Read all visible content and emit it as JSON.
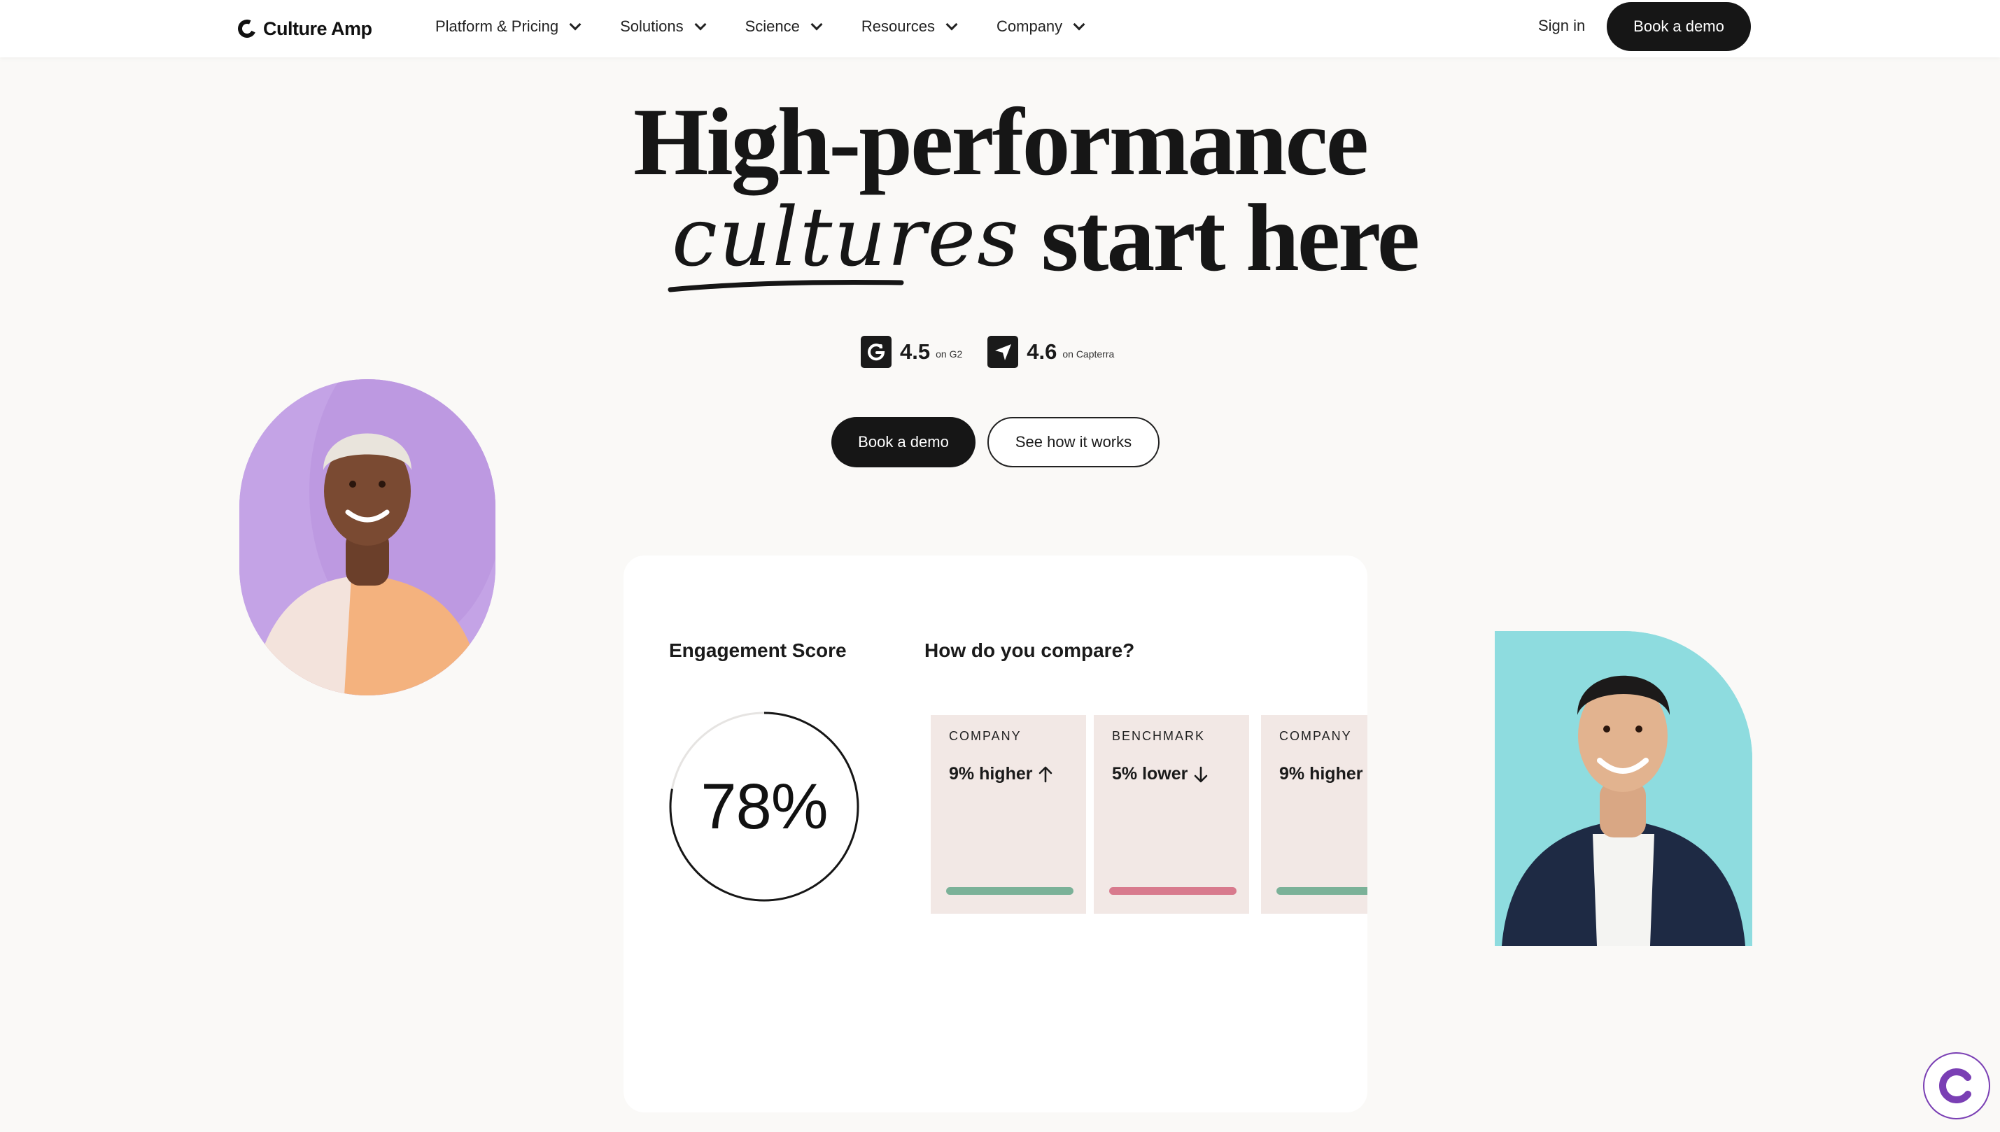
{
  "brand": {
    "name": "Culture Amp"
  },
  "nav": {
    "items": [
      {
        "label": "Platform & Pricing"
      },
      {
        "label": "Solutions"
      },
      {
        "label": "Science"
      },
      {
        "label": "Resources"
      },
      {
        "label": "Company"
      }
    ],
    "sign_in": "Sign in",
    "book_demo": "Book a demo"
  },
  "hero": {
    "line1": "High-performance",
    "script_word": "cultures",
    "line2_rest": "start here"
  },
  "ratings": [
    {
      "score": "4.5",
      "source": "on G2",
      "icon": "g2-logo-icon"
    },
    {
      "score": "4.6",
      "source": "on Capterra",
      "icon": "capterra-logo-icon"
    }
  ],
  "cta": {
    "primary": "Book a demo",
    "secondary": "See how it works"
  },
  "card": {
    "engagement_label": "Engagement Score",
    "engagement_value": "78%",
    "engagement_fraction": 0.78,
    "compare_label": "How do you compare?",
    "tiles": [
      {
        "kicker": "COMPANY",
        "value": "9% higher",
        "direction": "up",
        "bar_color": "#7bb198"
      },
      {
        "kicker": "BENCHMARK",
        "value": "5% lower",
        "direction": "down",
        "bar_color": "#d87a8d"
      },
      {
        "kicker": "COMPANY",
        "value": "9% higher",
        "direction": "none",
        "bar_color": "#7bb198"
      }
    ]
  },
  "colors": {
    "primary": "#161616",
    "page_bg": "#faf9f7",
    "chat_accent": "#7a3fb4"
  }
}
